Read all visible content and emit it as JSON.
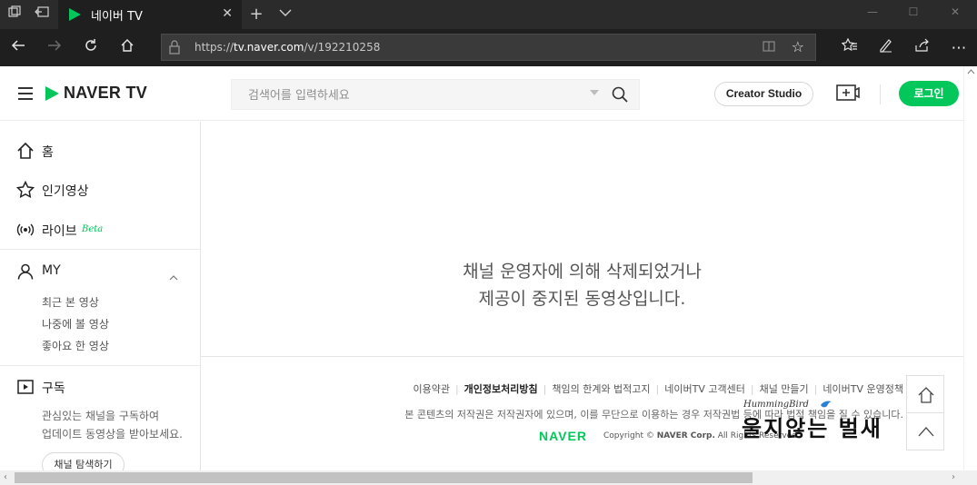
{
  "browser": {
    "tab_title": "네이버 TV",
    "url_prefix": "https://",
    "url_host": "tv.naver.com",
    "url_path": "/v/192210258"
  },
  "header": {
    "brand": "NAVER TV",
    "search_placeholder": "검색어를 입력하세요",
    "creator_studio": "Creator Studio",
    "login": "로그인"
  },
  "sidebar": {
    "home": "홈",
    "popular": "인기영상",
    "live": "라이브",
    "live_badge": "Beta",
    "my": "MY",
    "my_items": [
      "최근 본 영상",
      "나중에 볼 영상",
      "좋아요 한 영상"
    ],
    "subscribe": "구독",
    "subscribe_desc_1": "관심있는 채널을 구독하여",
    "subscribe_desc_2": "업데이트 동영상을 받아보세요.",
    "explore_button": "채널 탐색하기"
  },
  "main": {
    "message_line1": "채널 운영자에 의해 삭제되었거나",
    "message_line2": "제공이 중지된 동영상입니다."
  },
  "footer": {
    "links": [
      "이용약관",
      "개인정보처리방침",
      "책임의 한계와 법적고지",
      "네이버TV 고객센터",
      "채널 만들기",
      "네이버TV 운영정책"
    ],
    "notice": "본 콘텐츠의 저작권은 저작권자에 있으며, 이를 무단으로 이용하는 경우 저작권법 등에 따라 법적 책임을 질 수 있습니다.",
    "naver_logo": "NAVER",
    "copyright_prefix": "Copyright ©",
    "copyright_corp": "NAVER Corp.",
    "copyright_suffix": "All Rights Reserved."
  },
  "watermark": {
    "small": "HummingBird",
    "main": "울지않는 벌새"
  },
  "colors": {
    "brand_green": "#03c75a",
    "chrome_dark": "#1f1f1f"
  }
}
